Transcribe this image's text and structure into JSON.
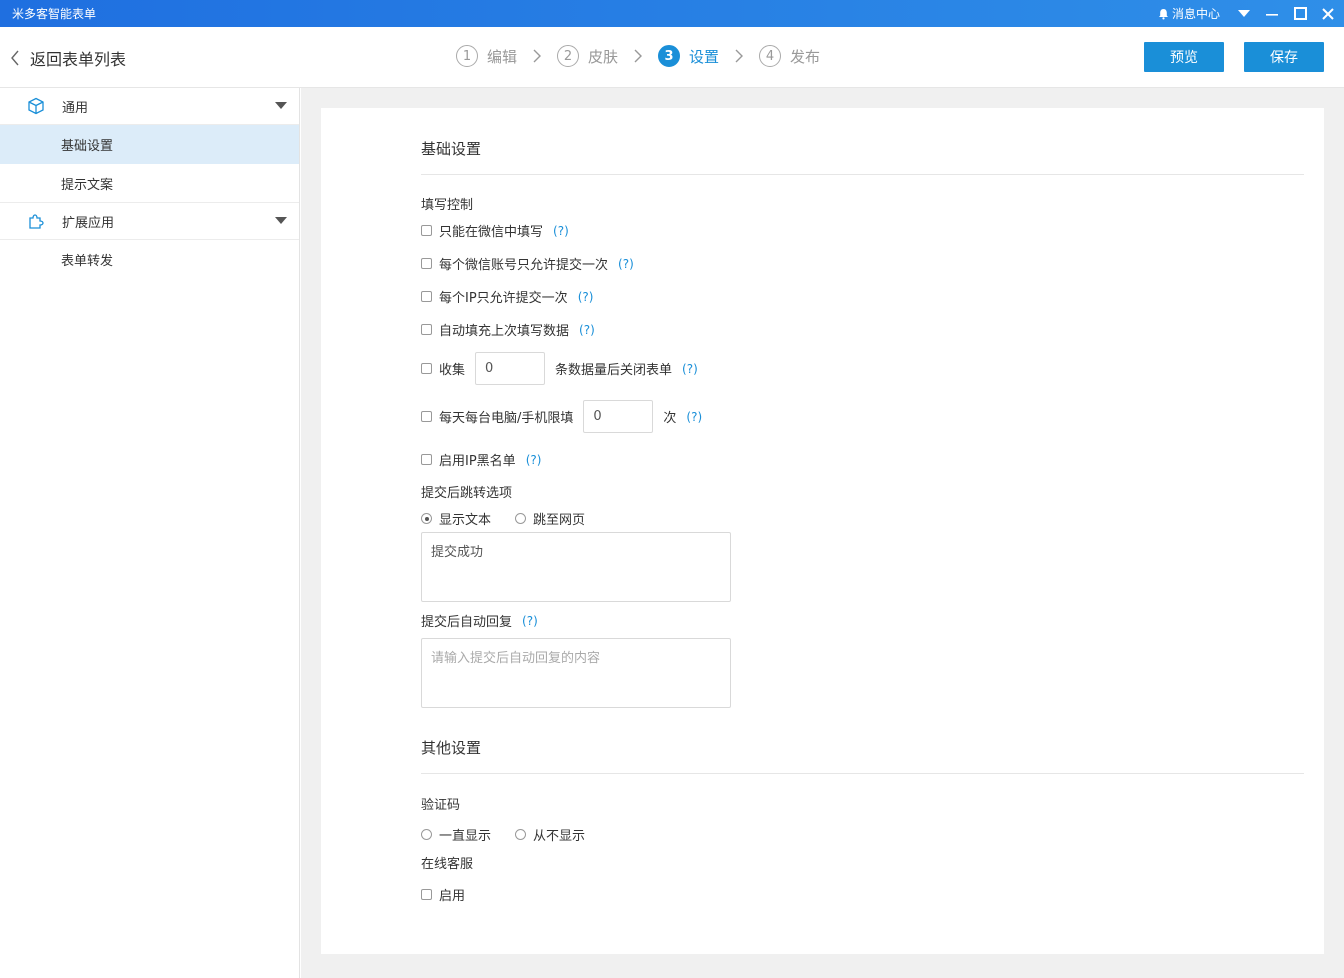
{
  "titlebar": {
    "app_title": "米多客智能表单",
    "message_center": "消息中心"
  },
  "header": {
    "back_label": "返回表单列表",
    "steps": [
      {
        "num": "1",
        "label": "编辑"
      },
      {
        "num": "2",
        "label": "皮肤"
      },
      {
        "num": "3",
        "label": "设置"
      },
      {
        "num": "4",
        "label": "发布"
      }
    ],
    "active_step": 3,
    "preview_label": "预览",
    "save_label": "保存"
  },
  "sidebar": {
    "groups": [
      {
        "label": "通用",
        "items": [
          "基础设置",
          "提示文案"
        ]
      },
      {
        "label": "扩展应用",
        "items": [
          "表单转发"
        ]
      }
    ],
    "active_item": "基础设置"
  },
  "basic": {
    "title": "基础设置",
    "fill_control_label": "填写控制",
    "help": "(?)",
    "options": {
      "wechat_only": "只能在微信中填写",
      "one_per_wechat": "每个微信账号只允许提交一次",
      "one_per_ip": "每个IP只允许提交一次",
      "autofill": "自动填充上次填写数据",
      "collect_prefix": "收集",
      "collect_value": "0",
      "collect_suffix": "条数据量后关闭表单",
      "daily_prefix": "每天每台电脑/手机限填",
      "daily_value": "0",
      "daily_suffix": "次",
      "ip_blacklist": "启用IP黑名单"
    },
    "after_submit_label": "提交后跳转选项",
    "after_submit_options": [
      "显示文本",
      "跳至网页"
    ],
    "after_submit_selected": "显示文本",
    "after_submit_text": "提交成功",
    "auto_reply_label": "提交后自动回复",
    "auto_reply_placeholder": "请输入提交后自动回复的内容"
  },
  "other": {
    "title": "其他设置",
    "captcha_label": "验证码",
    "captcha_options": [
      "一直显示",
      "从不显示"
    ],
    "online_service_label": "在线客服",
    "enable_label": "启用"
  },
  "colors": {
    "accent": "#1a8fd8",
    "titlebar": "#2f8fe8",
    "sidebar_active": "#dcecf9",
    "main_bg": "#f0f0f0"
  }
}
